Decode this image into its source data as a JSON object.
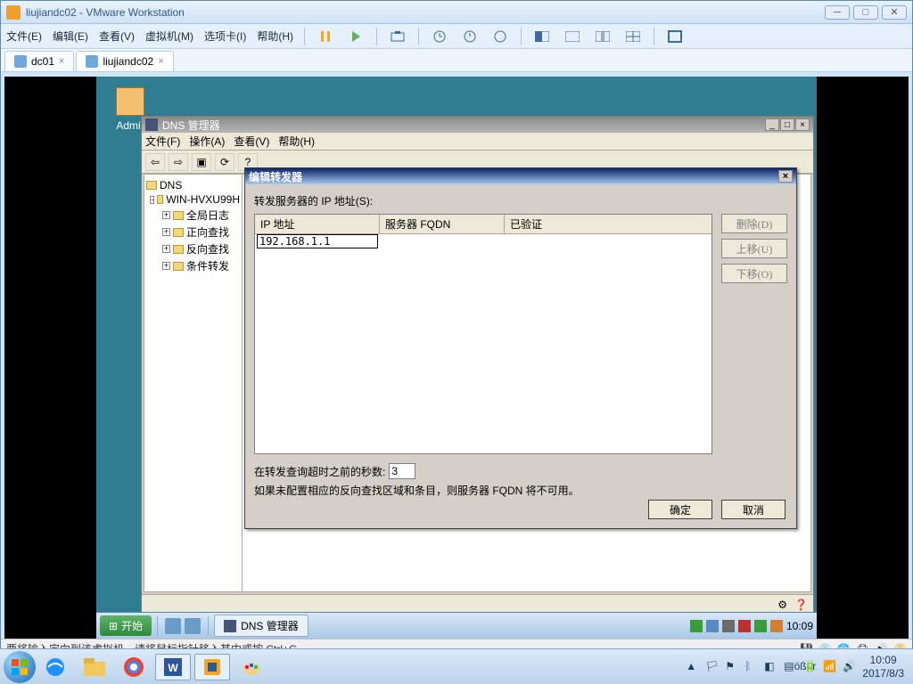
{
  "vmware": {
    "title": "liujiandc02 - VMware Workstation",
    "menus": [
      "文件(E)",
      "编辑(E)",
      "查看(V)",
      "虚拟机(M)",
      "选项卡(I)",
      "帮助(H)"
    ],
    "tabs": [
      {
        "label": "dc01"
      },
      {
        "label": "liujiandc02"
      }
    ],
    "statusbar": "要将输入定向到该虚拟机，请将鼠标指针移入其中或按 Ctrl+G。"
  },
  "guest": {
    "desktop_icon_label": "Admir",
    "taskbar": {
      "start": "开始",
      "task_item": "DNS 管理器",
      "time": "10:09"
    }
  },
  "dns_manager": {
    "title": "DNS 管理器",
    "menus": [
      "文件(F)",
      "操作(A)",
      "查看(V)",
      "帮助(H)"
    ],
    "tree": {
      "root": "DNS",
      "server": "WIN-HVXU99H",
      "items": [
        "全局日志",
        "正向查找",
        "反向查找",
        "条件转发"
      ]
    }
  },
  "forwarder": {
    "title": "编辑转发器",
    "ip_label": "转发服务器的 IP 地址(S):",
    "columns": {
      "ip": "IP 地址",
      "fqdn": "服务器 FQDN",
      "verified": "已验证"
    },
    "ip_value": "192.168.1.1",
    "buttons": {
      "delete": "删除(D)",
      "up": "上移(U)",
      "down": "下移(O)"
    },
    "timeout_label": "在转发查询超时之前的秒数:",
    "timeout_value": "3",
    "note": "如果未配置相应的反向查找区域和条目，则服务器 FQDN 将不可用。",
    "ok": "确定",
    "cancel": "取消"
  },
  "host": {
    "time": "10:09",
    "date": "2017/8/3"
  }
}
